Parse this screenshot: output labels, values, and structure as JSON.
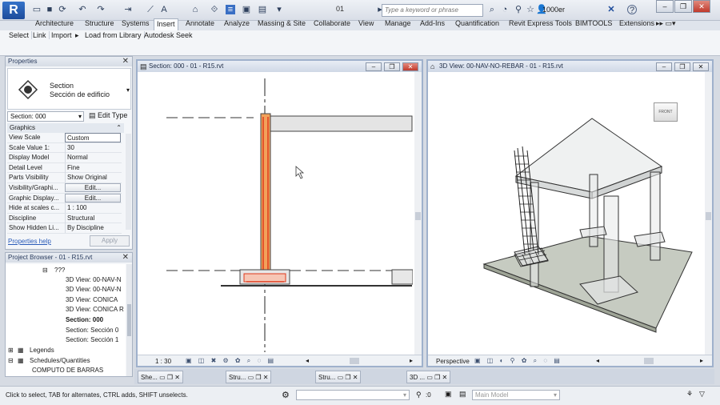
{
  "titlebar": {
    "doc_title": "01",
    "search_placeholder": "Type a keyword or phrase",
    "user": "1000er"
  },
  "ribbon_tabs": [
    "Architecture",
    "Structure",
    "Systems",
    "Insert",
    "Annotate",
    "Analyze",
    "Massing & Site",
    "Collaborate",
    "View",
    "Manage",
    "Add-Ins",
    "Quantification",
    "Revit Express Tools",
    "BIMTOOLS",
    "Extensions"
  ],
  "active_tab": "Insert",
  "ribbon_panel": [
    "Select",
    "Link",
    "Import",
    "Load from Library",
    "Autodesk Seek"
  ],
  "properties": {
    "title": "Properties",
    "type_name": "Section",
    "type_sub": "Sección de edificio",
    "selector": "Section: 000",
    "edit_type": "Edit Type",
    "group": "Graphics",
    "rows": [
      {
        "k": "View Scale",
        "v": "Custom"
      },
      {
        "k": "Scale Value    1:",
        "v": "30"
      },
      {
        "k": "Display Model",
        "v": "Normal"
      },
      {
        "k": "Detail Level",
        "v": "Fine"
      },
      {
        "k": "Parts Visibility",
        "v": "Show Original"
      },
      {
        "k": "Visibility/Graphi...",
        "v": "Edit..."
      },
      {
        "k": "Graphic Display...",
        "v": "Edit..."
      },
      {
        "k": "Hide at scales c...",
        "v": "1 : 100"
      },
      {
        "k": "Discipline",
        "v": "Structural"
      },
      {
        "k": "Show Hidden Li...",
        "v": "By Discipline"
      }
    ],
    "help": "Properties help",
    "apply": "Apply"
  },
  "browser": {
    "title": "Project Browser - 01 - R15.rvt",
    "items": [
      "???",
      "3D View: 00-NAV-N",
      "3D View: 00-NAV-N",
      "3D View: CONICA",
      "3D View: CONICA R",
      "Section: 000",
      "Section: Sección 0",
      "Section: Sección 1",
      "Legends",
      "Schedules/Quantities",
      "COMPUTO DE BARRAS"
    ]
  },
  "view_section": {
    "title": "Section: 000 - 01 - R15.rvt",
    "scale": "1 : 30"
  },
  "view_3d": {
    "title": "3D View: 00-NAV-NO-REBAR - 01 - R15.rvt",
    "mode": "Perspective",
    "viewcube": "FRONT"
  },
  "doc_tabs": [
    "She...",
    "Stru...",
    "Stru...",
    "3D ..."
  ],
  "status": {
    "text": "Click to select, TAB for alternates, CTRL adds, SHIFT unselects.",
    "zero": ":0",
    "model": "Main Model"
  },
  "colors": {
    "accent": "#3573c9",
    "rebar": "#e03a1c",
    "wall": "#f2a15a"
  }
}
